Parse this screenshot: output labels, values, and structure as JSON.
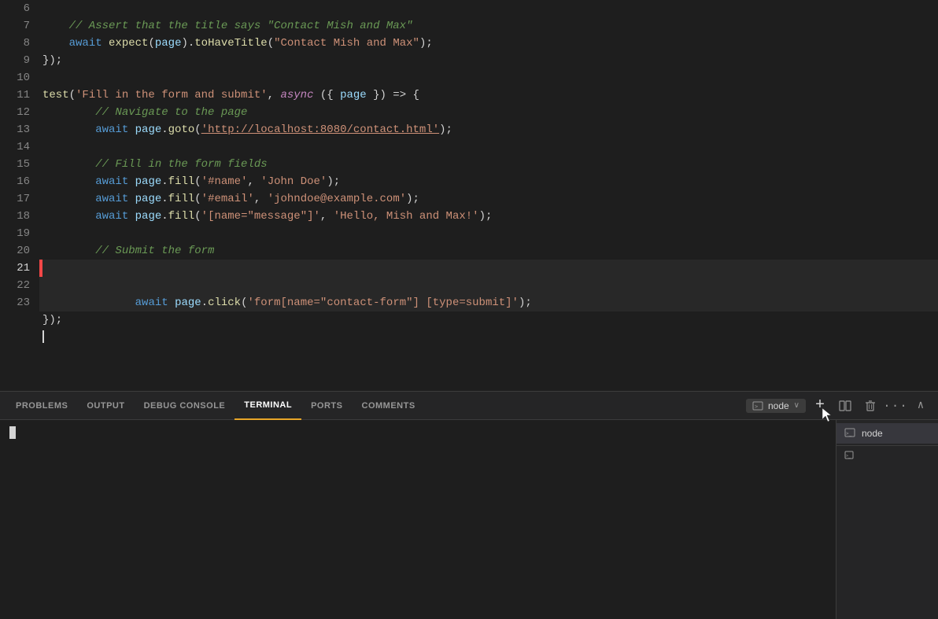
{
  "editor": {
    "lines": [
      {
        "num": 6,
        "content": []
      },
      {
        "num": 7,
        "tokens": [
          {
            "text": "    // Assert that the title says \"Contact Mish and Max\"",
            "class": "t-comment"
          }
        ]
      },
      {
        "num": 8,
        "tokens": [
          {
            "text": "    ",
            "class": "t-white"
          },
          {
            "text": "await",
            "class": "t-keyword"
          },
          {
            "text": " ",
            "class": "t-white"
          },
          {
            "text": "expect",
            "class": "t-yellow"
          },
          {
            "text": "(",
            "class": "t-white"
          },
          {
            "text": "page",
            "class": "t-param"
          },
          {
            "text": ").",
            "class": "t-white"
          },
          {
            "text": "toHaveTitle",
            "class": "t-yellow"
          },
          {
            "text": "(",
            "class": "t-white"
          },
          {
            "text": "\"Contact Mish and Max\"",
            "class": "t-string"
          },
          {
            "text": ");",
            "class": "t-white"
          }
        ]
      },
      {
        "num": 9,
        "tokens": [
          {
            "text": "});",
            "class": "t-white"
          }
        ]
      },
      {
        "num": 10,
        "content": []
      },
      {
        "num": 11,
        "tokens": [
          {
            "text": "test",
            "class": "t-yellow"
          },
          {
            "text": "(",
            "class": "t-white"
          },
          {
            "text": "'Fill in the form and submit'",
            "class": "t-string"
          },
          {
            "text": ", ",
            "class": "t-white"
          },
          {
            "text": "async",
            "class": "t-async"
          },
          {
            "text": " (",
            "class": "t-white"
          },
          {
            "text": "{",
            "class": "t-white"
          },
          {
            "text": " page ",
            "class": "t-param"
          },
          {
            "text": "}",
            "class": "t-white"
          },
          {
            "text": ") => {",
            "class": "t-white"
          }
        ]
      },
      {
        "num": 12,
        "tokens": [
          {
            "text": "    // Navigate to the page",
            "class": "t-comment"
          }
        ]
      },
      {
        "num": 13,
        "tokens": [
          {
            "text": "    ",
            "class": "t-white"
          },
          {
            "text": "await",
            "class": "t-keyword"
          },
          {
            "text": " ",
            "class": "t-white"
          },
          {
            "text": "page",
            "class": "t-param"
          },
          {
            "text": ".",
            "class": "t-white"
          },
          {
            "text": "goto",
            "class": "t-method"
          },
          {
            "text": "(",
            "class": "t-white"
          },
          {
            "text": "'http://localhost:8080/contact.html'",
            "class": "t-url"
          },
          {
            "text": ");",
            "class": "t-white"
          }
        ]
      },
      {
        "num": 14,
        "content": []
      },
      {
        "num": 15,
        "tokens": [
          {
            "text": "    // Fill in the form fields",
            "class": "t-comment"
          }
        ]
      },
      {
        "num": 16,
        "tokens": [
          {
            "text": "    ",
            "class": "t-white"
          },
          {
            "text": "await",
            "class": "t-keyword"
          },
          {
            "text": " ",
            "class": "t-white"
          },
          {
            "text": "page",
            "class": "t-param"
          },
          {
            "text": ".",
            "class": "t-white"
          },
          {
            "text": "fill",
            "class": "t-method"
          },
          {
            "text": "(",
            "class": "t-white"
          },
          {
            "text": "'#name'",
            "class": "t-string"
          },
          {
            "text": ", ",
            "class": "t-white"
          },
          {
            "text": "'John Doe'",
            "class": "t-string"
          },
          {
            "text": ");",
            "class": "t-white"
          }
        ]
      },
      {
        "num": 17,
        "tokens": [
          {
            "text": "    ",
            "class": "t-white"
          },
          {
            "text": "await",
            "class": "t-keyword"
          },
          {
            "text": " ",
            "class": "t-white"
          },
          {
            "text": "page",
            "class": "t-param"
          },
          {
            "text": ".",
            "class": "t-white"
          },
          {
            "text": "fill",
            "class": "t-method"
          },
          {
            "text": "(",
            "class": "t-white"
          },
          {
            "text": "'#email'",
            "class": "t-string"
          },
          {
            "text": ", ",
            "class": "t-white"
          },
          {
            "text": "'johndoe@example.com'",
            "class": "t-string"
          },
          {
            "text": ");",
            "class": "t-white"
          }
        ]
      },
      {
        "num": 18,
        "tokens": [
          {
            "text": "    ",
            "class": "t-white"
          },
          {
            "text": "await",
            "class": "t-keyword"
          },
          {
            "text": " ",
            "class": "t-white"
          },
          {
            "text": "page",
            "class": "t-param"
          },
          {
            "text": ".",
            "class": "t-white"
          },
          {
            "text": "fill",
            "class": "t-method"
          },
          {
            "text": "(",
            "class": "t-white"
          },
          {
            "text": "'[name=\"message\"]'",
            "class": "t-string"
          },
          {
            "text": ", ",
            "class": "t-white"
          },
          {
            "text": "'Hello, Mish and Max!'",
            "class": "t-string"
          },
          {
            "text": ");",
            "class": "t-white"
          }
        ]
      },
      {
        "num": 19,
        "content": []
      },
      {
        "num": 20,
        "tokens": [
          {
            "text": "    // Submit the form",
            "class": "t-comment"
          }
        ]
      },
      {
        "num": 21,
        "tokens": [
          {
            "text": "    ",
            "class": "t-white"
          },
          {
            "text": "await",
            "class": "t-keyword"
          },
          {
            "text": " ",
            "class": "t-white"
          },
          {
            "text": "page",
            "class": "t-param"
          },
          {
            "text": ".",
            "class": "t-white"
          },
          {
            "text": "click",
            "class": "t-method"
          },
          {
            "text": "(",
            "class": "t-white"
          },
          {
            "text": "'form[name=\"contact-form\"] [type=submit]'",
            "class": "t-string"
          },
          {
            "text": ");",
            "class": "t-white"
          }
        ],
        "active": true
      },
      {
        "num": 22,
        "tokens": [
          {
            "text": "});",
            "class": "t-white"
          }
        ]
      },
      {
        "num": 23,
        "content": []
      }
    ]
  },
  "terminal": {
    "tabs": [
      {
        "label": "PROBLEMS",
        "active": false
      },
      {
        "label": "OUTPUT",
        "active": false
      },
      {
        "label": "DEBUG CONSOLE",
        "active": false
      },
      {
        "label": "TERMINAL",
        "active": true
      },
      {
        "label": "PORTS",
        "active": false
      },
      {
        "label": "COMMENTS",
        "active": false
      }
    ],
    "controls": {
      "node_label": "node",
      "add_label": "+",
      "split_label": "⊞",
      "delete_label": "🗑",
      "more_label": "...",
      "collapse_label": "∧"
    },
    "sidebar_items": [
      {
        "label": "node",
        "icon": "terminal"
      },
      {
        "label": "",
        "icon": "terminal-small"
      }
    ]
  }
}
